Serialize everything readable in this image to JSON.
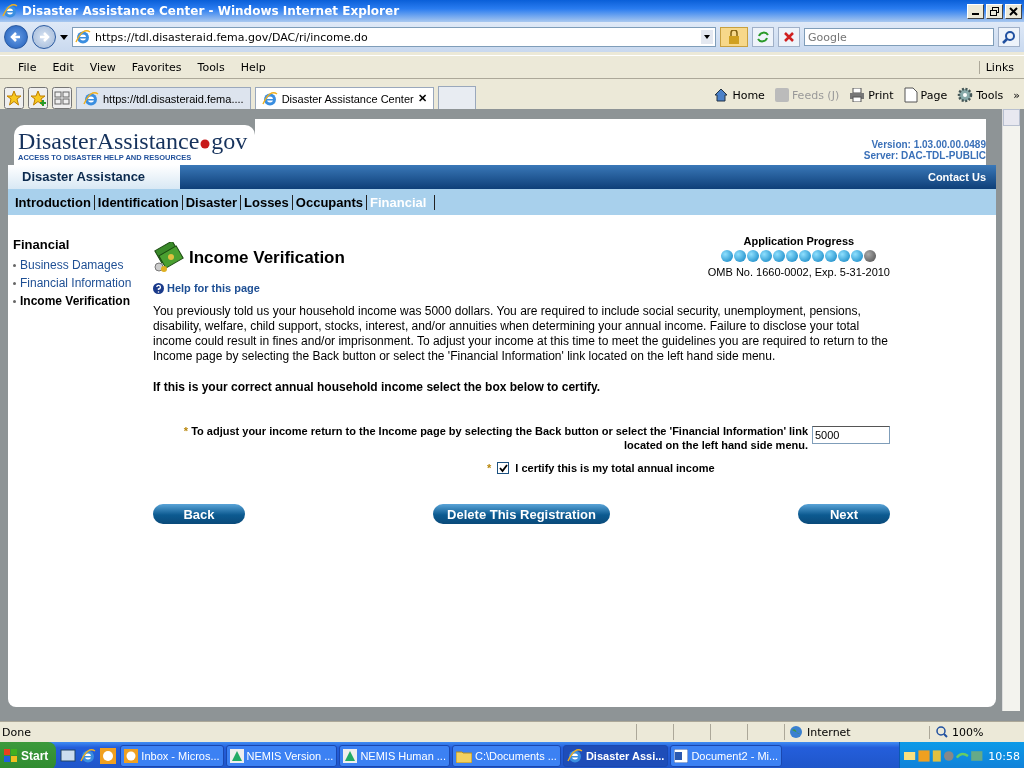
{
  "window": {
    "title": "Disaster Assistance Center - Windows Internet Explorer"
  },
  "address_bar": {
    "url": "https://tdl.disasteraid.fema.gov/DAC/ri/income.do",
    "search_placeholder": "Google"
  },
  "menu_bar": {
    "items": [
      "File",
      "Edit",
      "View",
      "Favorites",
      "Tools",
      "Help"
    ],
    "links": "Links"
  },
  "browser_tabs": [
    {
      "label": "https://tdl.disasteraid.fema....",
      "selected": false
    },
    {
      "label": "Disaster Assistance Center",
      "selected": true,
      "close": "✕"
    }
  ],
  "command_bar": [
    {
      "label": "Home",
      "kind": "home",
      "disabled": false
    },
    {
      "label": "Feeds (J)",
      "kind": "feeds",
      "disabled": true
    },
    {
      "label": "Print",
      "kind": "print",
      "disabled": false
    },
    {
      "label": "Page",
      "kind": "page",
      "disabled": false
    },
    {
      "label": "Tools",
      "kind": "tools",
      "disabled": false
    }
  ],
  "chevron": "»",
  "site_header": {
    "logo_main": "DisasterAssistance",
    "logo_suffix": "gov",
    "tagline": "ACCESS TO DISASTER HELP AND RESOURCES",
    "version": "Version: 1.03.00.00.0489",
    "server": "Server: DAC-TDL-PUBLIC",
    "section_tab": "Disaster Assistance",
    "contact": "Contact Us"
  },
  "nav_tabs": [
    {
      "label": "Introduction",
      "selected": false
    },
    {
      "label": "Identification",
      "selected": false
    },
    {
      "label": "Disaster",
      "selected": false
    },
    {
      "label": "Losses",
      "selected": false
    },
    {
      "label": "Occupants",
      "selected": false
    },
    {
      "label": "Financial",
      "selected": true
    }
  ],
  "sidebar": {
    "heading": "Financial",
    "items": [
      {
        "label": "Business Damages",
        "selected": false
      },
      {
        "label": "Financial Information",
        "selected": false
      },
      {
        "label": "Income Verification",
        "selected": true
      }
    ]
  },
  "page_title": "Income Verification",
  "progress": {
    "label": "Application Progress",
    "steps": [
      {
        "completed": true
      },
      {
        "completed": true
      },
      {
        "completed": true
      },
      {
        "completed": true
      },
      {
        "completed": true
      },
      {
        "completed": true
      },
      {
        "completed": true
      },
      {
        "completed": true
      },
      {
        "completed": true
      },
      {
        "completed": true
      },
      {
        "completed": true
      },
      {
        "completed": false
      }
    ],
    "omb": "OMB No. 1660-0002, Exp. 5-31-2010"
  },
  "help_link": "Help for this page",
  "intro_text": "You previously told us your household income was 5000 dollars. You are required to include social security, unemployment, pensions, disability, welfare, child support, stocks, interest, and/or annuities when determining your annual income. Failure to disclose your total income could result in fines and/or imprisonment. To adjust your income at this time to meet the guidelines you are required to return to the Income page by selecting the Back button or select the 'Financial Information' link located on the left hand side menu.",
  "certify_instruction": "If this is your correct annual household income select the box below to certify.",
  "income_field": {
    "required_mark": "*",
    "label": "To adjust your income return to the Income page by selecting the Back button or select the 'Financial Information' link located on the left hand side menu.",
    "value": "5000"
  },
  "certify": {
    "required_mark": "*",
    "label": "I certify this is my total annual income",
    "checked": true
  },
  "buttons": [
    {
      "label": "Back"
    },
    {
      "label": "Delete This Registration"
    },
    {
      "label": "Next"
    }
  ],
  "status_bar": {
    "status": "Done",
    "zone": "Internet",
    "zoom": "100%"
  },
  "taskbar": {
    "start": "Start",
    "tasks": [
      {
        "label": "Inbox - Micros...",
        "kind": "clock",
        "selected": false
      },
      {
        "label": "NEMIS Version ...",
        "kind": "app",
        "selected": false
      },
      {
        "label": "NEMIS Human ...",
        "kind": "app",
        "selected": false
      },
      {
        "label": "C:\\Documents ...",
        "kind": "folder",
        "selected": false
      },
      {
        "label": "Disaster Assi...",
        "kind": "ie",
        "selected": true
      },
      {
        "label": "Document2 - Mi...",
        "kind": "doc",
        "selected": false
      }
    ],
    "clock": "10:58"
  }
}
